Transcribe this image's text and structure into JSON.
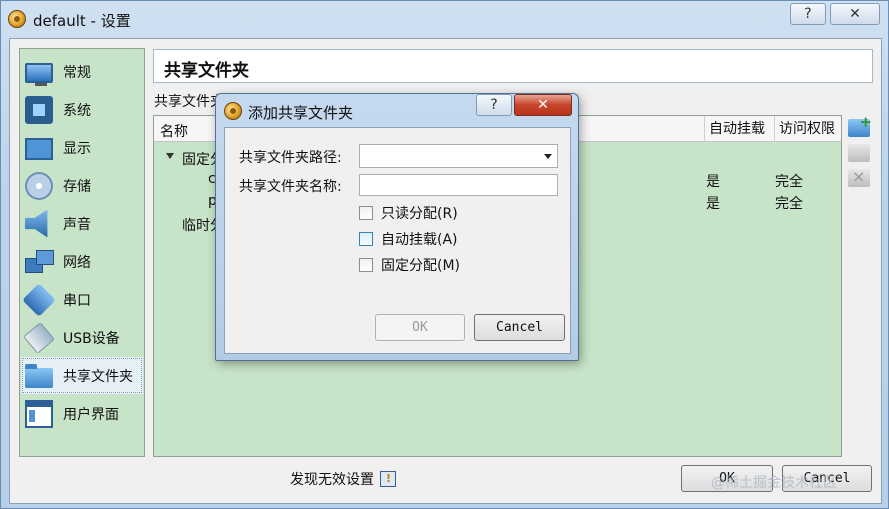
{
  "window": {
    "title": "default - 设置",
    "help_label": "?",
    "close_label": "✕"
  },
  "sidebar": {
    "items": [
      {
        "label": "常规",
        "icon": "general-icon"
      },
      {
        "label": "系统",
        "icon": "system-chip-icon"
      },
      {
        "label": "显示",
        "icon": "display-icon"
      },
      {
        "label": "存储",
        "icon": "storage-disk-icon"
      },
      {
        "label": "声音",
        "icon": "speaker-icon"
      },
      {
        "label": "网络",
        "icon": "network-icon"
      },
      {
        "label": "串口",
        "icon": "serial-port-icon"
      },
      {
        "label": "USB设备",
        "icon": "usb-icon"
      },
      {
        "label": "共享文件夹",
        "icon": "folder-icon",
        "selected": true
      },
      {
        "label": "用户界面",
        "icon": "user-interface-icon"
      }
    ]
  },
  "page": {
    "header": "共享文件夹",
    "section_label": "共享文件夹"
  },
  "table": {
    "columns": [
      "名称",
      "自动挂载",
      "访问权限"
    ],
    "group_fixed": "固定分",
    "row1_name_partial": "c",
    "row2_name_partial": "p",
    "group_temp": "临时分",
    "rows": [
      {
        "auto_mount": "是",
        "access": "完全"
      },
      {
        "auto_mount": "是",
        "access": "完全"
      }
    ]
  },
  "status": {
    "invalid_settings": "发现无效设置"
  },
  "buttons": {
    "ok": "OK",
    "cancel": "Cancel"
  },
  "watermark": "@稀土掘金技术社区",
  "dialog": {
    "title": "添加共享文件夹",
    "help_label": "?",
    "close_label": "✕",
    "path_label": "共享文件夹路径:",
    "name_label": "共享文件夹名称:",
    "path_value": "",
    "name_value": "",
    "checkboxes": [
      {
        "label": "只读分配(R)",
        "checked": false
      },
      {
        "label": "自动挂载(A)",
        "checked": false
      },
      {
        "label": "固定分配(M)",
        "checked": false
      }
    ],
    "ok": "OK",
    "cancel": "Cancel"
  },
  "colors": {
    "panel_green": "#c8e4c8",
    "titlebar_blue": "#c5d9ee",
    "close_red": "#c7452b"
  }
}
